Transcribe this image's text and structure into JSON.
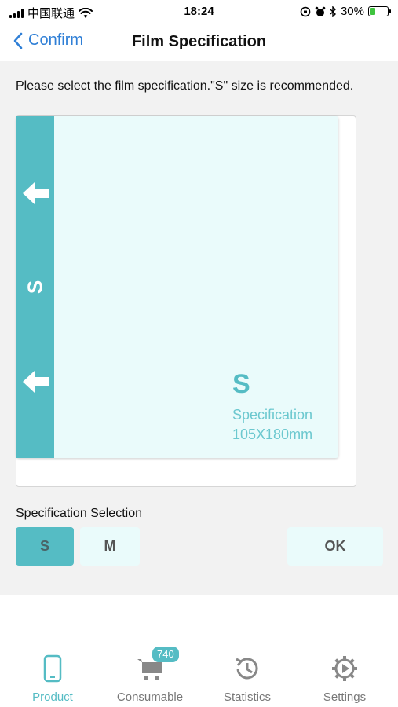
{
  "status_bar": {
    "carrier": "中国联通",
    "time": "18:24",
    "battery_percent": "30%",
    "battery_level": 0.3
  },
  "nav": {
    "back_label": "Confirm",
    "title": "Film Specification"
  },
  "instruction": "Please select the film specification.\"S\" size is recommended.",
  "film_preview": {
    "strip_letter": "S",
    "size_label": "S",
    "spec_label": "Specification",
    "dimensions": "105X180mm"
  },
  "selection": {
    "label": "Specification Selection",
    "options": [
      "S",
      "M"
    ],
    "selected": "S",
    "ok_label": "OK"
  },
  "tabs": [
    {
      "label": "Product",
      "icon": "phone-icon",
      "active": true
    },
    {
      "label": "Consumable",
      "icon": "cart-icon",
      "badge": "740"
    },
    {
      "label": "Statistics",
      "icon": "history-icon"
    },
    {
      "label": "Settings",
      "icon": "gear-icon"
    }
  ],
  "colors": {
    "accent": "#55bcc4",
    "link": "#2f7fd6",
    "film_bg": "#eafbfb"
  }
}
